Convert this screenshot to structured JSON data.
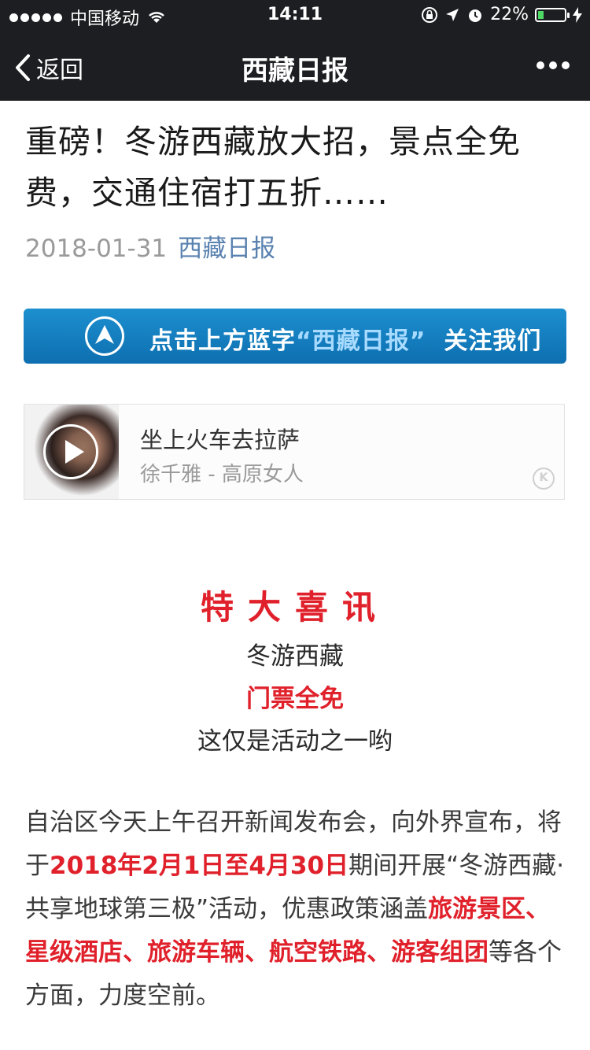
{
  "status_bar": {
    "carrier": "中国移动",
    "time": "14:11",
    "battery": "22%",
    "battery_level": 0.22
  },
  "nav": {
    "back_label": "返回",
    "title": "西藏日报"
  },
  "article": {
    "title": "重磅！冬游西藏放大招，景点全免费，交通住宿打五折……",
    "date": "2018-01-31",
    "account": "西藏日报",
    "follow_banner": {
      "prefix": "点击上方蓝字",
      "highlight": "“西藏日报”",
      "suffix": "关注我们"
    },
    "music": {
      "song": "坐上火车去拉萨",
      "singer": "徐千雅 - 高原女人",
      "badge": "K"
    },
    "headline": "特大喜讯",
    "line1": "冬游西藏",
    "line2": "门票全免",
    "line3": "这仅是活动之一哟",
    "paragraph": {
      "p1": "自治区今天上午召开新闻发布会，向外界宣布，将于",
      "p2": "2018年2月1日至4月30日",
      "p3": "期间开展“冬游西藏·共享地球第三极”活动，优惠政策涵盖",
      "p4": "旅游景区、星级酒店、旅游车辆、航空铁路、游客组团",
      "p5": "等各个方面，力度空前。"
    }
  },
  "colors": {
    "nav_bg": "#1d1e22",
    "accent_red": "#e0212b",
    "link_blue": "#5a82b0",
    "banner_blue": "#1281c2",
    "battery_green": "#4cd964"
  }
}
